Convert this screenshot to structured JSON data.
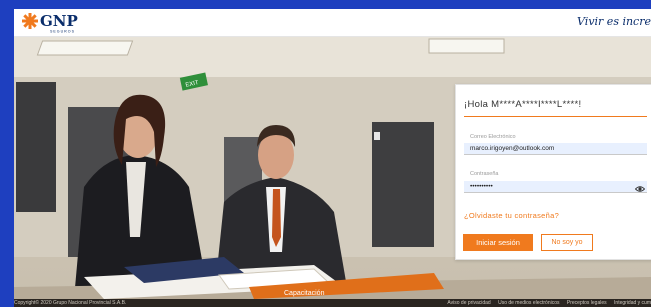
{
  "header": {
    "logo_text": "GNP",
    "logo_subtext": "SEGUROS",
    "tagline": "Vivir es incre"
  },
  "background": {
    "exit_sign": "EXIT",
    "banner_text": "Capacitación"
  },
  "login": {
    "greeting": "¡Hola M****A****I****L****!",
    "email_label": "Correo Electrónico",
    "email_value": "marco.irigoyen@outlook.com",
    "password_label": "Contraseña",
    "password_value": "••••••••••",
    "show_password_icon": "eye-icon",
    "forgot_link": "¿Olvidaste tu contraseña?",
    "login_button": "Iniciar sesión",
    "not_me_button": "No soy yo"
  },
  "footer": {
    "copyright": "Copyright© 2020 Grupo Nacional Provincial S.A.B.",
    "links": [
      "Aviso de privacidad",
      "Uso de medios electrónicos",
      "Preceptos legales",
      "Integridad y cum"
    ]
  },
  "colors": {
    "accent": "#f07a1e",
    "frame": "#1e3fbf",
    "brand_navy": "#0a2d6b",
    "autofill": "#e8f0fe"
  }
}
